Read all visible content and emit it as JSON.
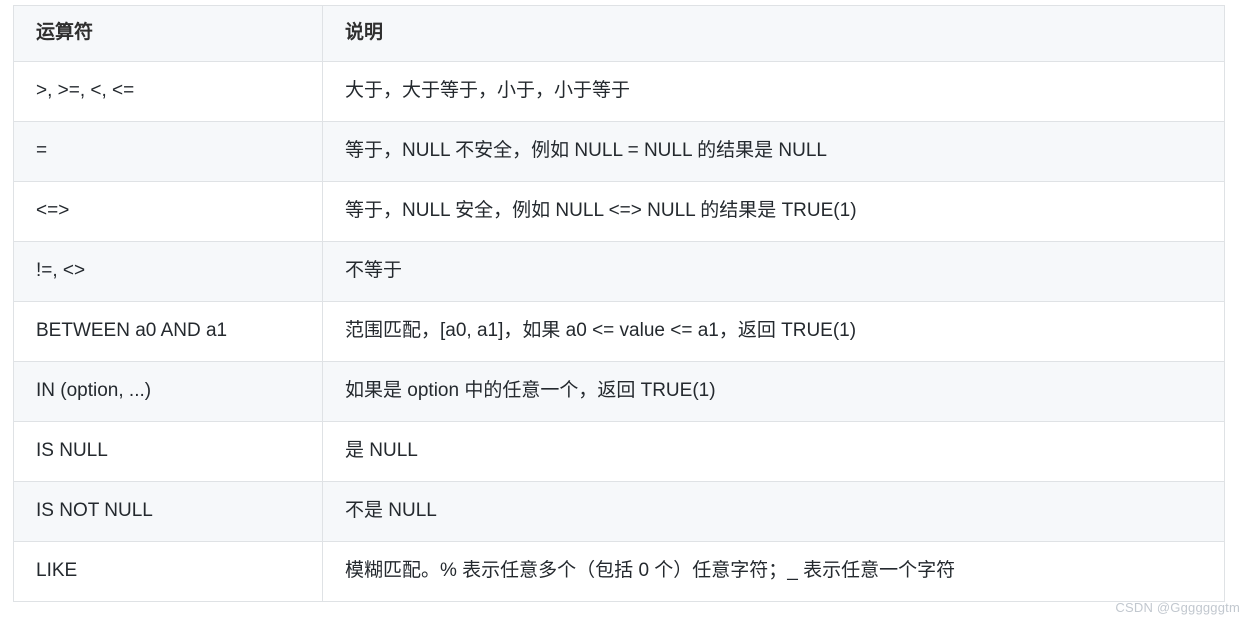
{
  "table": {
    "columns": [
      {
        "key": "operator",
        "label": "运算符"
      },
      {
        "key": "description",
        "label": "说明"
      }
    ],
    "rows": [
      {
        "operator": ">, >=, <, <=",
        "description": "大于，大于等于，小于，小于等于"
      },
      {
        "operator": "=",
        "description": "等于，NULL 不安全，例如 NULL = NULL 的结果是 NULL"
      },
      {
        "operator": "<=>",
        "description": "等于，NULL 安全，例如 NULL <=> NULL 的结果是 TRUE(1)"
      },
      {
        "operator": "!=, <>",
        "description": "不等于"
      },
      {
        "operator": "BETWEEN a0 AND a1",
        "description": "范围匹配，[a0, a1]，如果 a0 <= value <= a1，返回 TRUE(1)"
      },
      {
        "operator": "IN (option, ...)",
        "description": "如果是 option 中的任意一个，返回 TRUE(1)"
      },
      {
        "operator": "IS NULL",
        "description": "是 NULL"
      },
      {
        "operator": "IS NOT NULL",
        "description": "不是 NULL"
      },
      {
        "operator": "LIKE",
        "description": "模糊匹配。% 表示任意多个（包括 0 个）任意字符；_ 表示任意一个字符"
      }
    ]
  },
  "watermark": {
    "text": "CSDN @Gggggggtm"
  },
  "colors": {
    "header_bg": "#f6f8fa",
    "stripe_bg": "#f6f8fa",
    "row_bg": "#ffffff",
    "border": "#dfe2e5",
    "text": "#24292e",
    "watermark": "#c2c8cf"
  }
}
